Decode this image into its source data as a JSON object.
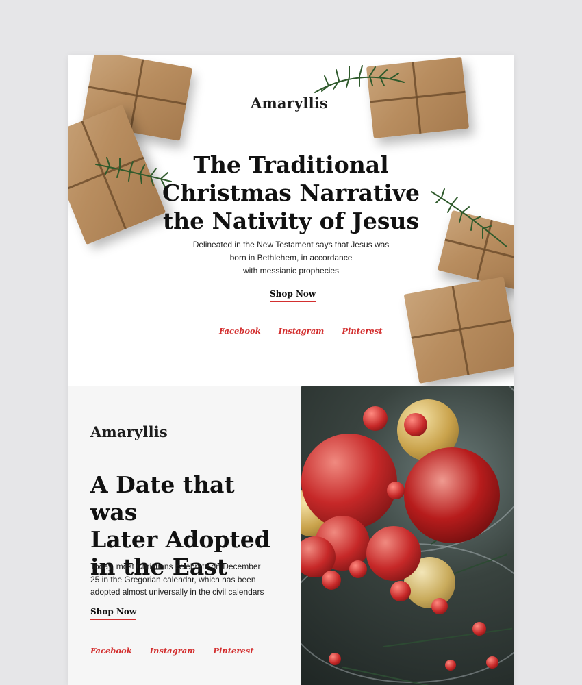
{
  "hero": {
    "logo": "Amaryllis",
    "title_lines": [
      "The Traditional",
      "Christmas Narrative",
      "the Nativity of Jesus"
    ],
    "subtitle_lines": [
      "Delineated in the New Testament says that Jesus was",
      "born in Bethlehem, in accordance",
      "with messianic prophecies"
    ],
    "shop_label": "Shop Now",
    "social": [
      "Facebook",
      "Instagram",
      "Pinterest"
    ]
  },
  "feature": {
    "logo": "Amaryllis",
    "title_lines": [
      "A Date that was",
      "Later Adopted",
      "in the East"
    ],
    "body_lines": [
      "Today, most Christians celebrate on December",
      "25 in the Gregorian calendar, which has been",
      "adopted almost universally in the civil calendars"
    ],
    "shop_label": "Shop Now",
    "social": [
      "Facebook",
      "Instagram",
      "Pinterest"
    ]
  },
  "colors": {
    "accent": "#d32f2f",
    "text": "#111111",
    "page_bg": "#e6e6e8",
    "section_bg": "#f6f6f6"
  }
}
